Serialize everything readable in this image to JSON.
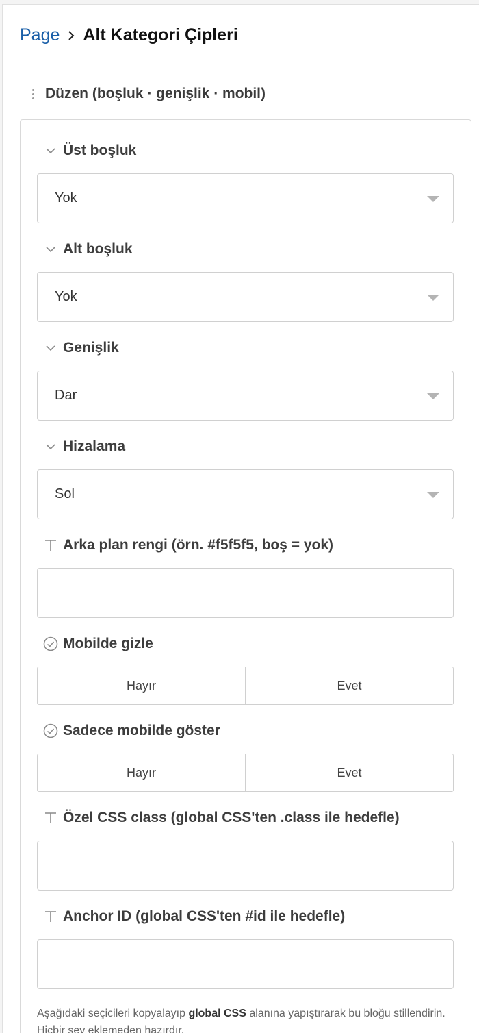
{
  "breadcrumb": {
    "root": "Page",
    "current": "Alt Kategori Çipleri"
  },
  "group": {
    "title": "Düzen (boşluk · genişlik · mobil)"
  },
  "fields": {
    "top_spacing": {
      "label": "Üst boşluk",
      "value": "Yok"
    },
    "bottom_spacing": {
      "label": "Alt boşluk",
      "value": "Yok"
    },
    "width": {
      "label": "Genişlik",
      "value": "Dar"
    },
    "alignment": {
      "label": "Hizalama",
      "value": "Sol"
    },
    "bg_color": {
      "label": "Arka plan rengi (örn. #f5f5f5, boş = yok)",
      "value": ""
    },
    "hide_mobile": {
      "label": "Mobilde gizle",
      "options": [
        "Hayır",
        "Evet"
      ]
    },
    "only_mobile": {
      "label": "Sadece mobilde göster",
      "options": [
        "Hayır",
        "Evet"
      ]
    },
    "css_class": {
      "label": "Özel CSS class (global CSS'ten .class ile hedefle)",
      "value": ""
    },
    "anchor_id": {
      "label": "Anchor ID (global CSS'ten #id ile hedefle)",
      "value": ""
    }
  },
  "help": {
    "before": "Aşağıdaki seçicileri kopyalayıp ",
    "bold": "global CSS",
    "after": " alanına yapıştırarak bu bloğu stillendirin. Hiçbir şey eklemeden hazırdır."
  },
  "icons": {
    "breadcrumb_separator": "chevron-right-icon",
    "group_handle": "drag-handle-icon",
    "select_field": "chevron-down-icon",
    "text_field": "text-type-icon",
    "boolean_field": "check-circle-icon"
  },
  "colors": {
    "link": "#1a5fa8",
    "border": "#d0d0d0",
    "label": "#3d3d3d"
  }
}
